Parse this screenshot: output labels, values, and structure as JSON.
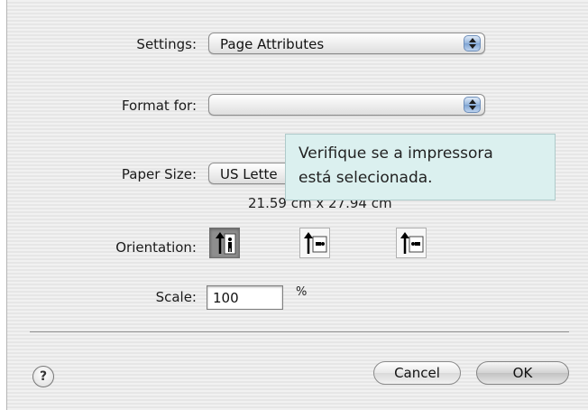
{
  "settings": {
    "label": "Settings:",
    "value": "Page Attributes"
  },
  "format_for": {
    "label": "Format for:",
    "value": ""
  },
  "tooltip": {
    "line1": "Verifique se a impressora",
    "line2": "está selecionada."
  },
  "paper_size": {
    "label": "Paper Size:",
    "value": "US Lette",
    "dimensions": "21.59 cm x 27.94 cm"
  },
  "orientation": {
    "label": "Orientation:",
    "options": [
      {
        "name": "portrait",
        "selected": true
      },
      {
        "name": "landscape-left",
        "selected": false
      },
      {
        "name": "landscape-right",
        "selected": false
      }
    ]
  },
  "scale": {
    "label": "Scale:",
    "value": "100",
    "unit": "%"
  },
  "buttons": {
    "help": "?",
    "cancel": "Cancel",
    "ok": "OK"
  }
}
